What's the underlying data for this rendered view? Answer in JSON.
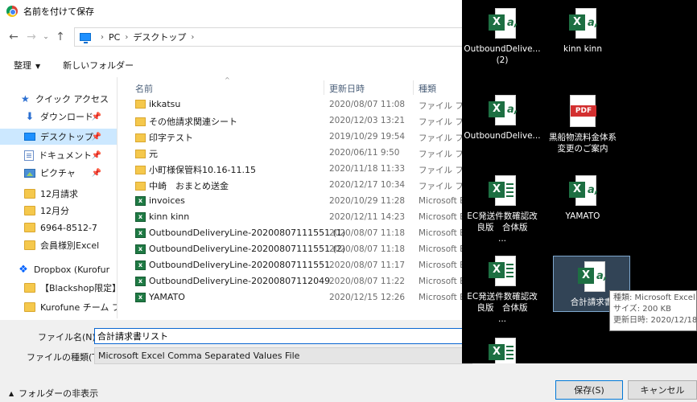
{
  "window": {
    "title": "名前を付けて保存"
  },
  "nav": {
    "back": "←",
    "forward": "→",
    "recent": "⌄",
    "up": "↑",
    "breadcrumbs": [
      "PC",
      "デスクトップ"
    ],
    "crumb_sep": "›"
  },
  "toolbar": {
    "organize_label": "整理",
    "organize_caret": "▼",
    "new_folder_label": "新しいフォルダー"
  },
  "sidebar": {
    "items": [
      {
        "label": "クイック アクセス",
        "icon": "star-icon",
        "pinned": false
      },
      {
        "label": "ダウンロード",
        "icon": "download-icon",
        "pinned": true
      },
      {
        "label": "デスクトップ",
        "icon": "desktop-icon",
        "pinned": true,
        "selected": true
      },
      {
        "label": "ドキュメント",
        "icon": "document-icon",
        "pinned": true
      },
      {
        "label": "ピクチャ",
        "icon": "picture-icon",
        "pinned": true
      },
      {
        "label": "12月請求",
        "icon": "folder-icon",
        "pinned": false
      },
      {
        "label": "12月分",
        "icon": "folder-icon",
        "pinned": false
      },
      {
        "label": "6964-8512-7",
        "icon": "folder-icon",
        "pinned": false
      },
      {
        "label": "会員様別Excel",
        "icon": "folder-icon",
        "pinned": false
      },
      {
        "label": "Dropbox (Kurofur",
        "icon": "dropbox-icon",
        "pinned": false
      },
      {
        "label": "【Blackshop限定】",
        "icon": "folder-icon",
        "pinned": false
      },
      {
        "label": "Kurofune チーム フ",
        "icon": "folder-icon",
        "pinned": false
      }
    ],
    "pin_glyph": "📌"
  },
  "filelist": {
    "columns": {
      "name": "名前",
      "modified": "更新日時",
      "type": "種類"
    },
    "sort_caret": "^",
    "rows": [
      {
        "name": "ikkatsu",
        "date": "2020/08/07 11:08",
        "type": "ファイル フォルダー",
        "kind": "folder"
      },
      {
        "name": "その他請求関連シート",
        "date": "2020/12/03 13:21",
        "type": "ファイル フォルダー",
        "kind": "folder"
      },
      {
        "name": "印字テスト",
        "date": "2019/10/29 19:54",
        "type": "ファイル フォルダー",
        "kind": "folder"
      },
      {
        "name": "元",
        "date": "2020/06/11 9:50",
        "type": "ファイル フォルダー",
        "kind": "folder"
      },
      {
        "name": "小町様保管料10.16-11.15",
        "date": "2020/11/18 11:33",
        "type": "ファイル フォルダー",
        "kind": "folder"
      },
      {
        "name": "中崎　おまとめ送金",
        "date": "2020/12/17 10:34",
        "type": "ファイル フォルダー",
        "kind": "folder"
      },
      {
        "name": "invoices",
        "date": "2020/10/29 11:28",
        "type": "Microsoft Excel",
        "kind": "excel"
      },
      {
        "name": "kinn kinn",
        "date": "2020/12/11 14:23",
        "type": "Microsoft Excel",
        "kind": "excel"
      },
      {
        "name": "OutboundDeliveryLine-20200807111551 (1)",
        "date": "2020/08/07 11:18",
        "type": "Microsoft Excel",
        "kind": "excel"
      },
      {
        "name": "OutboundDeliveryLine-20200807111551 (2)",
        "date": "2020/08/07 11:18",
        "type": "Microsoft Excel",
        "kind": "excel"
      },
      {
        "name": "OutboundDeliveryLine-20200807111551",
        "date": "2020/08/07 11:17",
        "type": "Microsoft Excel",
        "kind": "excel"
      },
      {
        "name": "OutboundDeliveryLine-20200807112049",
        "date": "2020/08/07 11:22",
        "type": "Microsoft Excel",
        "kind": "excel"
      },
      {
        "name": "YAMATO",
        "date": "2020/12/15 12:26",
        "type": "Microsoft Excel",
        "kind": "excel"
      }
    ]
  },
  "bottom": {
    "filename_label": "ファイル名(N):",
    "filename_value": "合計請求書リスト",
    "filetype_label": "ファイルの種類(T):",
    "filetype_value": "Microsoft Excel Comma Separated Values File",
    "hide_folders_label": "フォルダーの非表示",
    "hide_folders_caret": "▲",
    "save_label": "保存(S)",
    "cancel_label": "キャンセル"
  },
  "desktop": {
    "icons": [
      {
        "label": "OutboundDelive...\n(2)",
        "kind": "excel"
      },
      {
        "label": "kinn kinn",
        "kind": "excel"
      },
      {
        "label": "OutboundDelive...",
        "kind": "excel"
      },
      {
        "label": "黒船物流料金体系\n変更のご案内",
        "kind": "pdf"
      },
      {
        "label": "EC発送件数確認改\n良版　合体版\n...",
        "kind": "excel"
      },
      {
        "label": "YAMATO",
        "kind": "excel"
      },
      {
        "label": "EC発送件数確認改\n良版　合体版\n...",
        "kind": "excel"
      },
      {
        "label": "合計請求書",
        "kind": "excel"
      }
    ],
    "excel_badge": "X",
    "excel_mark": "a,",
    "pdf_badge": "PDF"
  },
  "tooltip": {
    "lines": [
      "種類: Microsoft Excel",
      "サイズ: 200 KB",
      "更新日時: 2020/12/18"
    ]
  }
}
